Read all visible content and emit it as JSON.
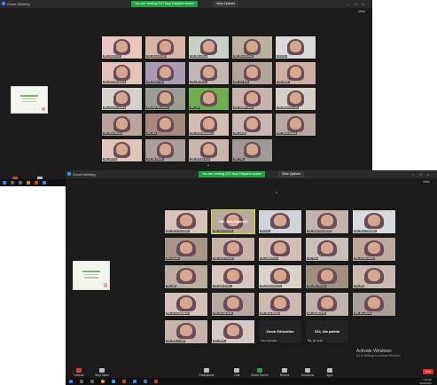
{
  "back_window": {
    "title": "Zoom Meeting",
    "share_banner": "You are viewing SITI Nuyi Fatyah's screen",
    "view_options": "View Options",
    "view_button": "View",
    "tiles": [
      {
        "name": "003_Cinda Putri",
        "c": "#e7c7c0"
      },
      {
        "name": "013_Dea Febrianti",
        "c": "#d7b5a7"
      },
      {
        "name": "016_Eka Aditya",
        "c": "#c8d1c6"
      },
      {
        "name": "006_Dea Amanda",
        "c": "#b9b09e"
      },
      {
        "name": "Siti Nuyi",
        "c": "#d9d9d9"
      },
      {
        "name": "012_Devi Handayani",
        "c": "#e3c3b8"
      },
      {
        "name": "026_Fatma Sari",
        "c": "#a99db3"
      },
      {
        "name": "011_Lilis Surya",
        "c": "#c4b6b2"
      },
      {
        "name": "004_Ayu Putri",
        "c": "#b5a49b"
      },
      {
        "name": "028_Nadia",
        "c": "#ccb1a3"
      },
      {
        "name": "009_Anniyah Shalika",
        "c": "#d6d2c9"
      },
      {
        "name": "015_Dwi Ramadhani",
        "c": "#989e92"
      },
      {
        "name": "022_Sari",
        "c": "#6fae4c"
      },
      {
        "name": "019_Dinda Pratiwi",
        "c": "#c9b3ab"
      },
      {
        "name": "005_Bellyandra Ayu",
        "c": "#d6cfc4"
      },
      {
        "name": "029_Dina Rizkiya",
        "c": "#b8a49c"
      },
      {
        "name": "024_Dini",
        "c": "#a5897f"
      },
      {
        "name": "023_Anisa Rosidiana",
        "c": "#d2bdb4"
      },
      {
        "name": "010_Lanisa",
        "c": "#cab7b1"
      },
      {
        "name": "007_Dhea Dwiana",
        "c": "#b7a9a0"
      },
      {
        "name": "025_Rahma",
        "c": "#e0c6bd"
      },
      {
        "name": "014_Ida Parida",
        "c": "#aaa09b"
      },
      {
        "name": "018_Anindya Putri",
        "c": "#c9b7ad"
      },
      {
        "name": "020_Tika",
        "c": "#9f9a96"
      }
    ],
    "toolbar": [
      {
        "label": "Unmute"
      },
      {
        "label": "Stop Video"
      }
    ]
  },
  "front_window": {
    "title": "Zoom Meeting",
    "share_banner": "You are viewing SITI Nuyi Fatyah's screen",
    "view_options": "View Options",
    "view_button": "View",
    "tiles": [
      {
        "name": "003_Rizka Ramadani",
        "c": "#d9c4bc"
      },
      {
        "name": "006_Dea Amanda",
        "c": "#b9ab9b",
        "active": true,
        "label": "006_Dea Amanda"
      },
      {
        "name": "Siti Nuyi",
        "c": "#cfd5d9"
      },
      {
        "name": "009_Salsa Ramadhani",
        "c": "#c1b4af"
      },
      {
        "name": "002_Rizka Salsabila",
        "c": "#d8dce0"
      },
      {
        "name": "020_Agustin",
        "c": "#a69788"
      },
      {
        "name": "026_Anisa Febriani",
        "c": "#c8b2aa"
      },
      {
        "name": "012_Nadia Putri",
        "c": "#d2c0b8"
      },
      {
        "name": "011_Tiara",
        "c": "#c7c0bb"
      },
      {
        "name": "019_Lia Ramadani",
        "c": "#bfa99f"
      },
      {
        "name": "024_Dini",
        "c": "#bcae9f"
      },
      {
        "name": "013_Dina Pratiwi",
        "c": "#d8c5bd"
      },
      {
        "name": "005_Bellyandra Ayu",
        "c": "#dad3ca"
      },
      {
        "name": "028_Dina Rizkiya",
        "c": "#a2907f"
      },
      {
        "name": "016_Rifa",
        "c": "#cab9b0"
      },
      {
        "name": "023_Anisa Rosidiana",
        "c": "#d4c2b9"
      },
      {
        "name": "010_Anneke Rizki",
        "c": "#b6a99f"
      },
      {
        "name": "007_Dhea Dwiana",
        "c": "#cabbb2"
      },
      {
        "name": "004_Ayudia Putri",
        "c": "#bdb3ab"
      },
      {
        "name": "025_Ida_parida",
        "c": "#ab9f97"
      },
      {
        "name": "015_Rahma Utari",
        "c": "#c6b4aa"
      },
      {
        "name": "027_Dinda",
        "c": "#d7c9c3"
      },
      {
        "name": "Zoom Education",
        "text": true,
        "label": "Zoom Education"
      },
      {
        "name": "014_Ida parida",
        "text": true,
        "label": "014_Ida parida"
      }
    ],
    "toolbar": [
      {
        "label": "Unmute"
      },
      {
        "label": "Stop Video"
      },
      {
        "label": "Participants"
      },
      {
        "label": "Chat"
      },
      {
        "label": "Share Screen"
      },
      {
        "label": "Record"
      },
      {
        "label": "Reactions"
      },
      {
        "label": "Apps"
      }
    ],
    "end_label": "End",
    "activate_title": "Activate Windows",
    "activate_sub": "Go to Settings to activate Windows."
  },
  "taskbar": {
    "time": "7:18 AM",
    "date": "5/20/2022"
  },
  "colors": {
    "banner_green": "#21a33f",
    "active_border": "#c8e03a",
    "end_red": "#e02828"
  }
}
